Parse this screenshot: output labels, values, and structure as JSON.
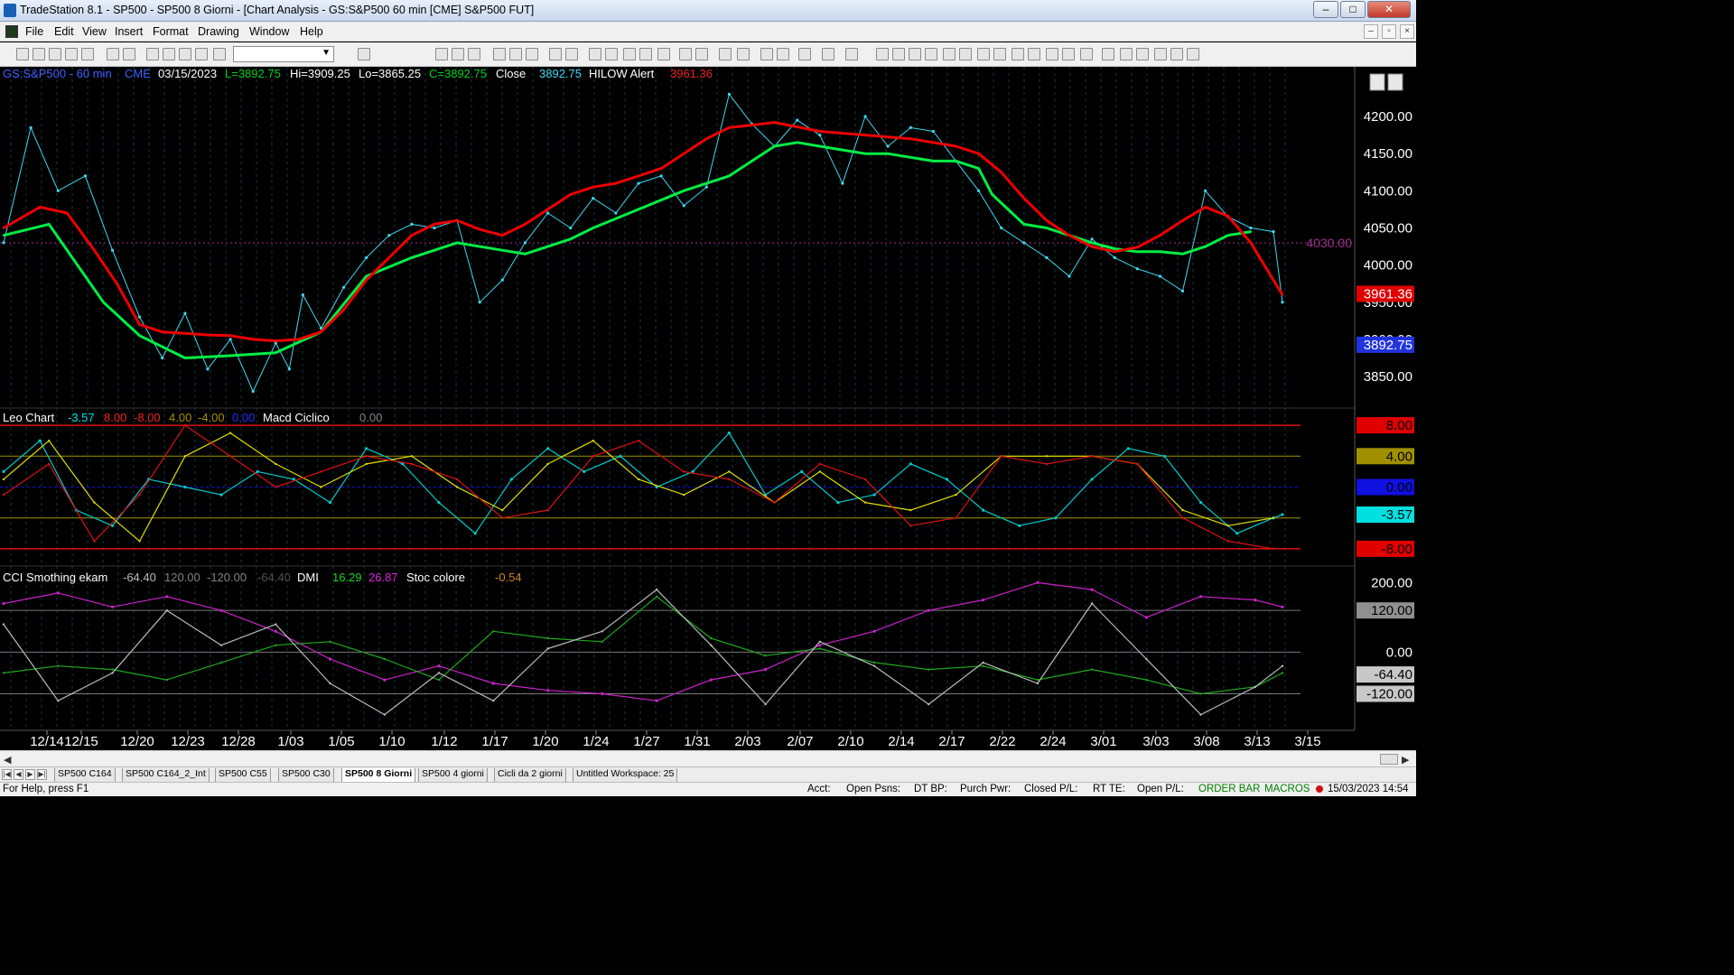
{
  "window": {
    "title": "TradeStation 8.1 - SP500 - SP500 8 Giorni - [Chart Analysis - GS:S&P500  60 min  [CME] S&P500 FUT]",
    "minimize": "‒",
    "maximize": "□",
    "close": "✕"
  },
  "menu": [
    "File",
    "Edit",
    "View",
    "Insert",
    "Format",
    "Drawing",
    "Window",
    "Help"
  ],
  "toolbar": {
    "combo_value": ""
  },
  "price_header": {
    "symbol": "GS:S&P500 - 60 min",
    "exchange": "CME",
    "date": "03/15/2023",
    "last": "L=3892.75",
    "hi": "Hi=3909.25",
    "lo": "Lo=3865.25",
    "close_val": "C=3892.75",
    "close_label": "Close",
    "close_num": "3892.75",
    "alert_label": "HILOW Alert",
    "alert_value": "3961.36"
  },
  "leo_header": {
    "name": "Leo Chart",
    "v1": "-3.57",
    "v2": "8.00",
    "v3": "-8.00",
    "v4": "4.00",
    "v5": "-4.00",
    "v6": "0.00",
    "macd": "Macd Ciclico",
    "macd_val": "0.00"
  },
  "cci_header": {
    "name": "CCI Smothing ekam",
    "v1": "-64.40",
    "v2": "120.00",
    "v3": "-120.00",
    "v4": "-64.40",
    "dmi": "DMI",
    "dmi1": "16.29",
    "dmi2": "26.87",
    "stoc": "Stoc colore",
    "stoc_val": "-0.54"
  },
  "axis": {
    "price_ticks": [
      "4200.00",
      "4150.00",
      "4100.00",
      "4050.00",
      "4000.00",
      "3950.00",
      "3900.00",
      "3850.00"
    ],
    "price_line_label": "4030.00",
    "price_badges": [
      {
        "text": "3961.36",
        "color": "#e00000"
      },
      {
        "text": "3892.75",
        "color": "#2233dd"
      }
    ],
    "leo_badges": [
      {
        "text": "8.00",
        "color": "#e00000"
      },
      {
        "text": "4.00",
        "color": "#a09000"
      },
      {
        "text": "0.00",
        "color": "#1010e0"
      },
      {
        "text": "-3.57",
        "color": "#00e0e0"
      },
      {
        "text": "-8.00",
        "color": "#e00000"
      }
    ],
    "cci_ticks": [
      "200.00",
      "120.00",
      "0.00",
      "-64.40",
      "-120.00"
    ],
    "dates": [
      "12/14",
      "12/15",
      "12/20",
      "12/23",
      "12/28",
      "1/03",
      "1/05",
      "1/10",
      "1/12",
      "1/17",
      "1/20",
      "1/24",
      "1/27",
      "1/31",
      "2/03",
      "2/07",
      "2/10",
      "2/14",
      "2/17",
      "2/22",
      "2/24",
      "3/01",
      "3/03",
      "3/08",
      "3/13",
      "3/15"
    ]
  },
  "chart_data": {
    "type": "line",
    "price_pane": {
      "ylim": [
        3810,
        4245
      ],
      "reference_line": 4030,
      "series": [
        {
          "name": "GS:S&P500 - 60 min",
          "color": "#40d8f0",
          "x": [
            0,
            6,
            12,
            18,
            24,
            30,
            35,
            40,
            45,
            50,
            55,
            60,
            63,
            66,
            70,
            75,
            80,
            85,
            90,
            95,
            100,
            105,
            110,
            115,
            120,
            125,
            130,
            135,
            140,
            145,
            150,
            155,
            160,
            165,
            170,
            175,
            180,
            185,
            190,
            195,
            200,
            205,
            210,
            215,
            220,
            225,
            230,
            235,
            240,
            245,
            250,
            255,
            260,
            265,
            270,
            275,
            280,
            282
          ],
          "y": [
            4030,
            4185,
            4100,
            4120,
            4020,
            3930,
            3875,
            3935,
            3860,
            3900,
            3830,
            3895,
            3860,
            3960,
            3915,
            3970,
            4010,
            4040,
            4055,
            4050,
            4060,
            3950,
            3980,
            4030,
            4070,
            4050,
            4090,
            4070,
            4110,
            4120,
            4080,
            4105,
            4230,
            4190,
            4160,
            4195,
            4175,
            4110,
            4200,
            4160,
            4185,
            4180,
            4140,
            4100,
            4050,
            4030,
            4010,
            3985,
            4035,
            4010,
            3995,
            3985,
            3965,
            4100,
            4065,
            4050,
            4045,
            3950
          ]
        },
        {
          "name": "",
          "color": "#00ee44",
          "x": [
            0,
            10,
            22,
            30,
            40,
            50,
            60,
            70,
            80,
            90,
            100,
            110,
            115,
            125,
            130,
            140,
            150,
            160,
            165,
            170,
            175,
            180,
            185,
            190,
            195,
            200,
            205,
            210,
            215,
            218,
            225,
            230,
            235,
            240,
            245,
            250,
            255,
            260,
            265,
            270,
            275
          ],
          "y": [
            4040,
            4055,
            3950,
            3905,
            3875,
            3878,
            3882,
            3910,
            3985,
            4010,
            4030,
            4020,
            4015,
            4035,
            4050,
            4075,
            4100,
            4120,
            4140,
            4160,
            4165,
            4160,
            4155,
            4150,
            4150,
            4145,
            4140,
            4140,
            4130,
            4095,
            4055,
            4050,
            4040,
            4030,
            4022,
            4018,
            4018,
            4015,
            4025,
            4040,
            4045
          ]
        },
        {
          "name": "",
          "color": "#ee0000",
          "x": [
            0,
            8,
            14,
            20,
            25,
            30,
            35,
            40,
            45,
            50,
            55,
            60,
            65,
            70,
            75,
            80,
            85,
            90,
            95,
            100,
            105,
            110,
            115,
            120,
            125,
            130,
            135,
            140,
            145,
            150,
            155,
            160,
            170,
            180,
            190,
            200,
            205,
            210,
            215,
            220,
            225,
            230,
            235,
            240,
            245,
            250,
            255,
            260,
            265,
            270,
            275,
            282
          ],
          "y": [
            4050,
            4078,
            4070,
            4020,
            3975,
            3920,
            3910,
            3908,
            3906,
            3905,
            3900,
            3898,
            3900,
            3910,
            3940,
            3980,
            4010,
            4040,
            4055,
            4060,
            4048,
            4040,
            4055,
            4075,
            4095,
            4105,
            4110,
            4120,
            4130,
            4150,
            4170,
            4185,
            4192,
            4180,
            4175,
            4170,
            4165,
            4160,
            4150,
            4125,
            4090,
            4060,
            4040,
            4025,
            4018,
            4024,
            4040,
            4060,
            4078,
            4066,
            4030,
            3960
          ]
        }
      ]
    },
    "leo_pane": {
      "ylim": [
        -10,
        10
      ],
      "levels": [
        8,
        4,
        0,
        -4,
        -8
      ],
      "series": [
        {
          "name": "",
          "color": "#00cccc",
          "x": [
            0,
            8,
            16,
            24,
            32,
            40,
            48,
            56,
            64,
            72,
            80,
            88,
            96,
            104,
            112,
            120,
            128,
            136,
            144,
            152,
            160,
            168,
            176,
            184,
            192,
            200,
            208,
            216,
            224,
            232,
            240,
            248,
            256,
            264,
            272,
            280,
            282
          ],
          "y": [
            2,
            6,
            -3,
            -5,
            1,
            0,
            -1,
            2,
            1,
            -2,
            5,
            3,
            -2,
            -6,
            1,
            5,
            2,
            4,
            0,
            2,
            7,
            -1,
            2,
            -2,
            -1,
            3,
            1,
            -3,
            -5,
            -4,
            1,
            5,
            4,
            -2,
            -6,
            -4,
            -3.57
          ]
        },
        {
          "name": "",
          "color": "#e0e000",
          "x": [
            0,
            10,
            20,
            30,
            40,
            50,
            60,
            70,
            80,
            90,
            100,
            110,
            120,
            130,
            140,
            150,
            160,
            170,
            180,
            190,
            200,
            210,
            220,
            230,
            240,
            250,
            260,
            270,
            280
          ],
          "y": [
            1,
            6,
            -2,
            -7,
            4,
            7,
            3,
            0,
            3,
            4,
            0,
            -3,
            3,
            6,
            1,
            -1,
            2,
            -2,
            2,
            -2,
            -3,
            -1,
            4,
            4,
            4,
            3,
            -3,
            -5,
            -4
          ]
        },
        {
          "name": "",
          "color": "#dd1111",
          "x": [
            0,
            10,
            20,
            30,
            40,
            50,
            60,
            70,
            80,
            90,
            100,
            110,
            120,
            130,
            140,
            150,
            160,
            170,
            180,
            190,
            200,
            210,
            220,
            230,
            240,
            250,
            260,
            270,
            280
          ],
          "y": [
            -1,
            3,
            -7,
            -1,
            8,
            4,
            0,
            2,
            4,
            3,
            1,
            -4,
            -3,
            4,
            6,
            2,
            1,
            -2,
            3,
            1,
            -5,
            -4,
            4,
            3,
            4,
            3,
            -4,
            -7,
            -8
          ]
        }
      ]
    },
    "cci_pane": {
      "ylim": [
        -220,
        240
      ],
      "levels": [
        120,
        0,
        -120
      ],
      "series": [
        {
          "name": "",
          "color": "#cc22cc",
          "x": [
            0,
            12,
            24,
            36,
            48,
            60,
            72,
            84,
            96,
            108,
            120,
            132,
            144,
            156,
            168,
            180,
            192,
            204,
            216,
            228,
            240,
            252,
            264,
            276,
            282
          ],
          "y": [
            140,
            170,
            130,
            160,
            120,
            60,
            -20,
            -80,
            -40,
            -90,
            -110,
            -120,
            -140,
            -80,
            -50,
            20,
            60,
            120,
            150,
            200,
            180,
            100,
            160,
            150,
            130
          ]
        },
        {
          "name": "",
          "color": "#1ea81e",
          "x": [
            0,
            12,
            24,
            36,
            48,
            60,
            72,
            84,
            96,
            108,
            120,
            132,
            144,
            156,
            168,
            180,
            192,
            204,
            216,
            228,
            240,
            252,
            264,
            276,
            282
          ],
          "y": [
            -60,
            -40,
            -50,
            -80,
            -30,
            20,
            30,
            -20,
            -80,
            60,
            40,
            30,
            160,
            40,
            -10,
            10,
            -30,
            -50,
            -40,
            -80,
            -50,
            -80,
            -120,
            -100,
            -60
          ]
        },
        {
          "name": "",
          "color": "#bbbbbb",
          "x": [
            0,
            12,
            24,
            36,
            48,
            60,
            72,
            84,
            96,
            108,
            120,
            132,
            144,
            156,
            168,
            180,
            192,
            204,
            216,
            228,
            240,
            252,
            264,
            276,
            282
          ],
          "y": [
            80,
            -140,
            -60,
            120,
            20,
            80,
            -90,
            -180,
            -60,
            -140,
            10,
            60,
            180,
            20,
            -150,
            30,
            -40,
            -150,
            -30,
            -90,
            140,
            -20,
            -180,
            -100,
            -40
          ]
        }
      ]
    }
  },
  "tabs": [
    "SP500 C164",
    "SP500 C164_2_Int",
    "SP500 C55",
    "SP500 C30",
    "SP500 8 Giorni",
    "SP500 4 giorni",
    "Cicli da 2 giorni",
    "Untitled Workspace:  25"
  ],
  "active_tab": "SP500 8 Giorni",
  "status": {
    "help": "For Help, press F1",
    "acct": "Acct:",
    "open_psns": "Open Psns:",
    "dt_bp": "DT BP:",
    "purch_pwr": "Purch Pwr:",
    "closed_pl": "Closed P/L:",
    "rt_te": "RT TE:",
    "open_pl": "Open P/L:",
    "order_bar": "ORDER BAR",
    "macros": "MACROS",
    "datetime": "15/03/2023 14:54"
  }
}
